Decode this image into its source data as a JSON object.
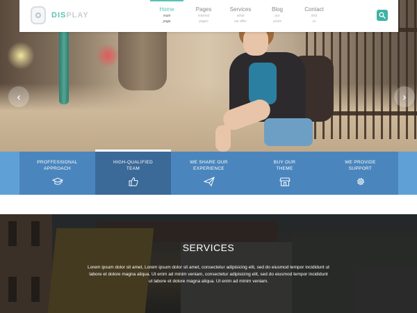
{
  "brand": {
    "logo_a": "DIS",
    "logo_b": "PLAY",
    "accent_color": "#56c3b4"
  },
  "nav": {
    "items": [
      {
        "label": "Home",
        "sub1": "main",
        "sub2": "page",
        "active": true
      },
      {
        "label": "Pages",
        "sub1": "internal",
        "sub2": "pages",
        "active": false
      },
      {
        "label": "Services",
        "sub1": "what",
        "sub2": "we offer",
        "active": false
      },
      {
        "label": "Blog",
        "sub1": "our",
        "sub2": "posts",
        "active": false
      },
      {
        "label": "Contact",
        "sub1": "find",
        "sub2": "us",
        "active": false
      }
    ],
    "search_icon": "search-icon"
  },
  "slider": {
    "prev_icon": "chevron-left-icon",
    "next_icon": "chevron-right-icon",
    "prev": "‹",
    "next": "›"
  },
  "features": {
    "strip_color": "#5fa1d6",
    "items": [
      {
        "line1": "PROFFESSIONAL",
        "line2": "APPROACH",
        "icon": "graduation-cap-icon"
      },
      {
        "line1": "HIGH-QUALIFIED",
        "line2": "TEAM",
        "icon": "thumbs-up-icon"
      },
      {
        "line1": "WE SHARE OUR",
        "line2": "EXPERIENCE",
        "icon": "paper-plane-icon"
      },
      {
        "line1": "BUY OUR",
        "line2": "THEME",
        "icon": "shop-icon"
      },
      {
        "line1": "WE PROVIDE",
        "line2": "SUPPORT",
        "icon": "gear-icon"
      }
    ]
  },
  "services": {
    "title": "SERVICES",
    "text": "Lorem ipsum dolor sit amet, Lorem ipsum dolor sit amet, consectetur adipisicing elit, sed do eiusmod tempor incididunt ut labore et dolore magna aliqua. Ut enim ad minim veniam, consectetur adipisicing elit, sed do eiusmod tempor incididunt ut labore et dolore magna aliqua. Ut enim ad minim veniam."
  }
}
